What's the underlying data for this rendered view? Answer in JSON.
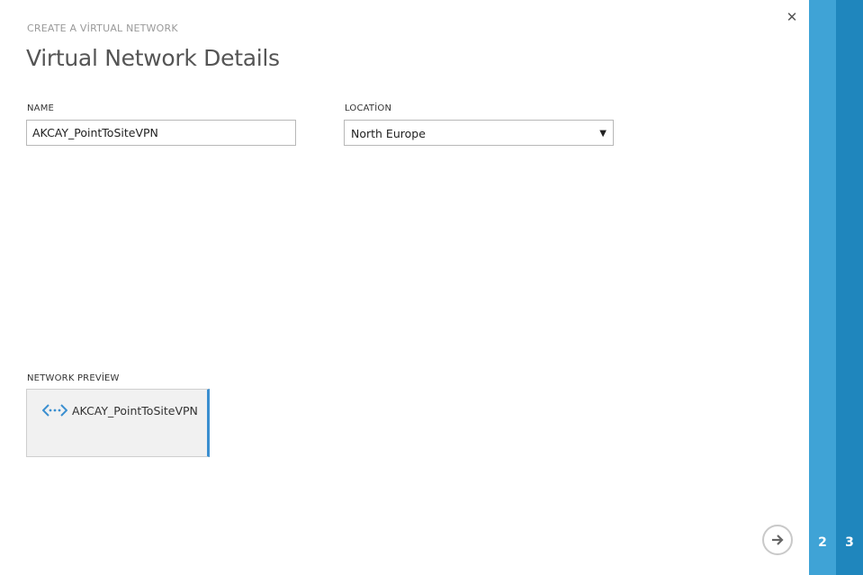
{
  "wizard": {
    "subtitle": "CREATE A VİRTUAL NETWORK",
    "title": "Virtual Network Details",
    "close_icon": "close-icon"
  },
  "form": {
    "name_label": "NAME",
    "name_value": "AKCAY_PointToSiteVPN",
    "location_label": "LOCATİON",
    "location_value": "North Europe",
    "location_arrow": "▼"
  },
  "preview": {
    "label": "NETWORK PREVİEW",
    "network_name": "AKCAY_PointToSiteVPN",
    "icon": "virtual-network-icon",
    "accent": "#3b8fd0"
  },
  "navigation": {
    "next_icon": "arrow-right-circle-icon",
    "steps": [
      {
        "number": "2",
        "color": "#3fa3d6"
      },
      {
        "number": "3",
        "color": "#1f86bd"
      }
    ]
  }
}
